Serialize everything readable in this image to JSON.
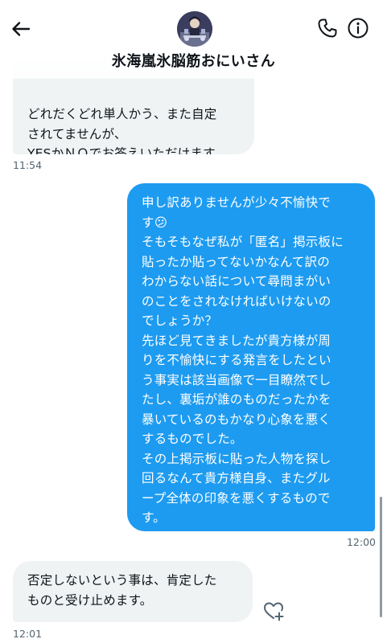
{
  "header": {
    "title": "氷海嵐氷脳筋おにいさん"
  },
  "messages": [
    {
      "direction": "incoming",
      "text": "どれだくどれ単人かう、また自定\nされてませんが、\nYESかＮＯでお答えいただけます\nか。",
      "time": "11:54"
    },
    {
      "direction": "outgoing",
      "text": "申し訳ありませんが少々不愉快で\nす😕\nそもそもなぜ私が「匿名」掲示板に\n貼ったか貼ってないかなんて訳の\nわからない話について尋問まがい\nのことをされなければいけないの\nでしょうか？\n先ほど見てきましたが貴方様が周\nりを不愉快にする発言をしたとい\nう事実は該当画像で一目瞭然でし\nたし、裏垢が誰のものだったかを\n暴いているのもかなり心象を悪く\nするものでした。\nその上掲示板に貼った人物を探し\n回るなんて貴方様自身、またグル\nープ全体の印象を悪くするもので\nす。",
      "time": "12:00"
    },
    {
      "direction": "incoming",
      "text": "否定しないという事は、肯定した\nものと受け止めます。",
      "time": "12:01"
    }
  ],
  "icons": {
    "back": "arrow-left-icon",
    "call": "phone-icon",
    "info": "info-icon",
    "react": "heart-plus-icon"
  },
  "colors": {
    "outgoing_bubble": "#1d9bf0",
    "incoming_bubble": "#eff3f4",
    "timestamp": "#536471"
  }
}
